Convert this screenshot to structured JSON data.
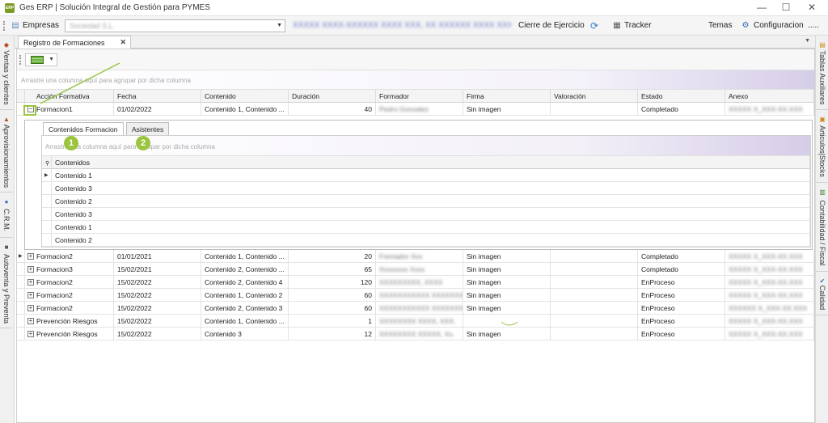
{
  "window": {
    "title": "Ges ERP | Solución Integral de Gestión para PYMES",
    "logo_text": "ERP",
    "controls": [
      "—",
      "☐",
      "✕"
    ]
  },
  "toolbar": {
    "empresas_label": "Empresas",
    "empresa_value": "Sociedad S.L.",
    "blurred_info": "XXXXX XXXX-XXXXXX XXXX XXX, XX XXXXXX XXXX XXX",
    "cierre_label": "Cierre de Ejercicio",
    "tracker_label": "Tracker",
    "temas_label": "Temas",
    "config_label": "Configuracion",
    "more_label": "....."
  },
  "left_dock": [
    {
      "label": "Ventas y clientes",
      "icon": "sales-icon"
    },
    {
      "label": "Aprovisionamientos",
      "icon": "supply-icon"
    },
    {
      "label": "C.R.M.",
      "icon": "crm-icon"
    },
    {
      "label": "Autoventa y Preventa",
      "icon": "autoventa-icon"
    }
  ],
  "right_dock": [
    {
      "label": "Tablas Auxiliares",
      "icon": "tables-icon"
    },
    {
      "label": "Articulos|Stocks",
      "icon": "stocks-icon"
    },
    {
      "label": "Contabilidad / Fiscal",
      "icon": "accounting-icon"
    },
    {
      "label": "Calidad",
      "icon": "quality-icon"
    }
  ],
  "doc_tab": {
    "label": "Registro de Formaciones",
    "close": "✕"
  },
  "group_hint": "Arrastre una columna aquí para agrupar por dicha columna",
  "columns": [
    "Acción Formativa",
    "Fecha",
    "Contenido",
    "Duración",
    "Formador",
    "Firma",
    "Valoración",
    "Estado",
    "Anexo"
  ],
  "rows": [
    {
      "accion": "Formacion1",
      "fecha": "01/02/2022",
      "contenido": "Contenido 1, Contenido ...",
      "duracion": "40",
      "formador": "Pedro Gonzalez",
      "firma": "Sin imagen",
      "valoracion": "",
      "estado": "Completado",
      "anexo": "XXXXX X_XXX-XX.XXX",
      "expander": "⊟"
    },
    {
      "accion": "Formacion2",
      "fecha": "01/01/2021",
      "contenido": "Contenido 1, Contenido ...",
      "duracion": "20",
      "formador": "Formador Xxx",
      "firma": "Sin imagen",
      "valoracion": "",
      "estado": "Completado",
      "anexo": "XXXXX X_XXX-XX.XXX",
      "expander": "⊞"
    },
    {
      "accion": "Formacion3",
      "fecha": "15/02/2021",
      "contenido": "Contenido 2, Contenido ...",
      "duracion": "65",
      "formador": "Xxxxxxxx Xxxx",
      "firma": "Sin imagen",
      "valoracion": "",
      "estado": "Completado",
      "anexo": "XXXXX X_XXX-XX.XXX",
      "expander": "⊞"
    },
    {
      "accion": "Formacion2",
      "fecha": "15/02/2022",
      "contenido": "Contenido 2, Contenido 4",
      "duracion": "120",
      "formador": "XXXXXXXXX, XXXX",
      "firma": "Sin imagen",
      "valoracion": "",
      "estado": "EnProceso",
      "anexo": "XXXXX X_XXX-XX.XXX",
      "expander": "⊞"
    },
    {
      "accion": "Formacion2",
      "fecha": "15/02/2022",
      "contenido": "Contenido 1, Contenido 2",
      "duracion": "60",
      "formador": "XXXXXXXXXXX XXXXXXXXX",
      "firma": "Sin imagen",
      "valoracion": "",
      "estado": "EnProceso",
      "anexo": "XXXXX X_XXX-XX.XXX",
      "expander": "⊞"
    },
    {
      "accion": "Formacion2",
      "fecha": "15/02/2022",
      "contenido": "Contenido 2, Contenido 3",
      "duracion": "60",
      "formador": "XXXXXXXXXXX XXXXXXXXX",
      "firma": "Sin imagen",
      "valoracion": "",
      "estado": "EnProceso",
      "anexo": "XXXXXX X_XXX-XX.XXX",
      "expander": "⊞"
    },
    {
      "accion": "Prevención Riesgos",
      "fecha": "15/02/2022",
      "contenido": "Contenido 1, Contenido ...",
      "duracion": "1",
      "formador": "XXXXXXXX XXXX, XXX.",
      "firma": "",
      "valoracion": "",
      "estado": "EnProceso",
      "anexo": "XXXXX X_XXX-XX.XXX",
      "expander": "⊞"
    },
    {
      "accion": "Prevención Riesgos",
      "fecha": "15/02/2022",
      "contenido": "Contenido 3",
      "duracion": "12",
      "formador": "XXXXXXXX XXXXX, Xx.",
      "firma": "Sin imagen",
      "valoracion": "",
      "estado": "EnProceso",
      "anexo": "XXXXX X_XXX-XX.XXX",
      "expander": "⊞"
    }
  ],
  "detail": {
    "tabs": [
      "Contenidos Formacion",
      "Asistentes"
    ],
    "group_hint": "Arrastre una columna aquí para agrupar por dicha columna",
    "column": "Contenidos",
    "items": [
      "Contenido 1",
      "Contenido 3",
      "Contenido 2",
      "Contenido 3",
      "Contenido 1",
      "Contenido 2"
    ]
  },
  "callouts": [
    "1",
    "2"
  ],
  "colors": {
    "accent_green": "#9bc43f",
    "detail_gradient": "#d6cde8"
  }
}
